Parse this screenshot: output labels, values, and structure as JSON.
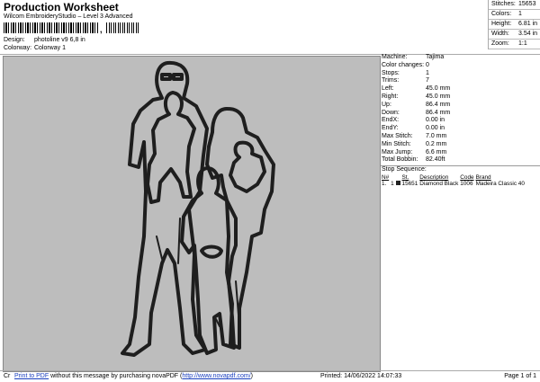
{
  "header": {
    "title": "Production Worksheet",
    "subtitle": "Wilcom EmbroideryStudio – Level 3 Advanced",
    "barcode_sep": ","
  },
  "meta": {
    "design_label": "Design:",
    "design_value": "photoline v9 6,8 in",
    "colorway_label": "Colorway:",
    "colorway_value": "Colorway 1"
  },
  "stats": [
    {
      "label": "Stitches:",
      "value": "15653"
    },
    {
      "label": "Colors:",
      "value": "1"
    },
    {
      "label": "Height:",
      "value": "6.81 in"
    },
    {
      "label": "Width:",
      "value": "3.54 in"
    },
    {
      "label": "Zoom:",
      "value": "1:1"
    }
  ],
  "info": [
    {
      "label": "Machine:",
      "value": "Tajima"
    },
    {
      "label": "Color changes:",
      "value": "0"
    },
    {
      "label": "Stops:",
      "value": "1"
    },
    {
      "label": "Trims:",
      "value": "7"
    },
    {
      "label": "Left:",
      "value": "45.0 mm"
    },
    {
      "label": "Right:",
      "value": "45.0 mm"
    },
    {
      "label": "Up:",
      "value": "86.4 mm"
    },
    {
      "label": "Down:",
      "value": "86.4 mm"
    },
    {
      "label": "EndX:",
      "value": "0.00 in"
    },
    {
      "label": "EndY:",
      "value": "0.00 in"
    },
    {
      "label": "Max Stitch:",
      "value": "7.0 mm"
    },
    {
      "label": "Min Stitch:",
      "value": "0.2 mm"
    },
    {
      "label": "Max Jump:",
      "value": "6.6 mm"
    },
    {
      "label": "Total Bobbin:",
      "value": "82.40ft"
    }
  ],
  "sequence": {
    "title": "Stop Sequence:",
    "headers": {
      "num": "N#",
      "st": "St.",
      "desc": "Description",
      "code": "Code",
      "brand": "Brand"
    },
    "rows": [
      {
        "n": "1.",
        "stop": "1",
        "swatch_color": "#222222",
        "st": "15651",
        "desc": "Diamond Black",
        "code": "1006",
        "brand": "Madeira Classic 40"
      }
    ]
  },
  "footer": {
    "left_fragment": "Cr",
    "link_text": "Print to PDF",
    "mid_text": " without this message by purchasing novaPDF (",
    "url_text": "http://www.novapdf.com/",
    "end_text": ")",
    "printed": "Printed: 14/06/2022 14:07:33",
    "page": "Page 1 of 1"
  }
}
